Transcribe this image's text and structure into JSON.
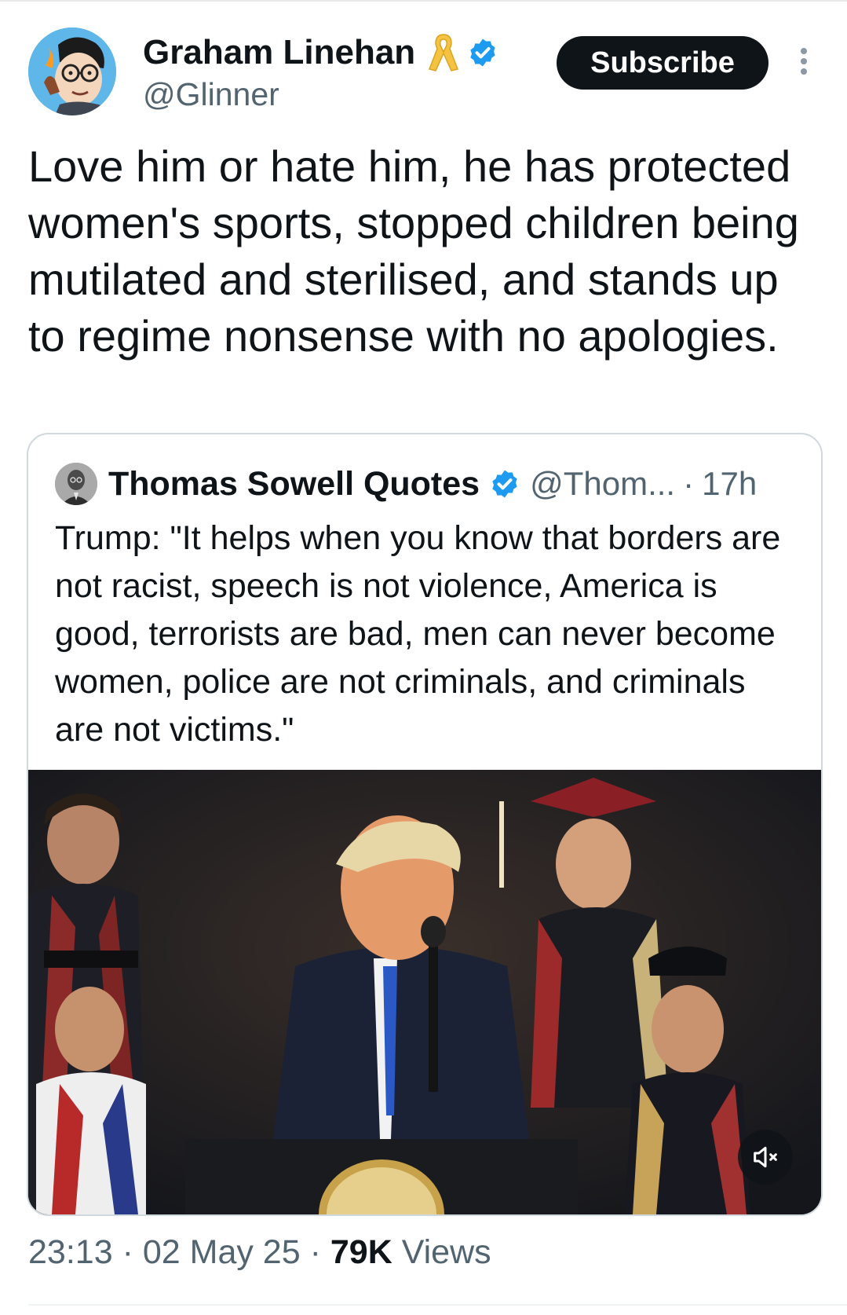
{
  "author": {
    "name": "Graham Linehan",
    "handle": "@Glinner",
    "avatar_icon": "cartoon-avatar-icon",
    "badges": [
      "yellow-ribbon-icon",
      "verified-badge-icon"
    ]
  },
  "header": {
    "subscribe_label": "Subscribe",
    "more_icon": "more-vertical-icon"
  },
  "tweet": {
    "text": "Love him or hate him, he has protected women's sports, stopped children being mutilated and sterilised, and stands up to regime nonsense with no apologies."
  },
  "quote": {
    "name": "Thomas Sowell Quotes",
    "handle": "@Thom...",
    "separator": "·",
    "time": "17h",
    "text": "Trump: \"It helps when you know that borders are not racist, speech is not violence, America is good, terrorists are bad, men can never become women, police are not criminals, and criminals are not victims.\"",
    "media": {
      "type": "video",
      "mute_icon": "volume-muted-icon"
    }
  },
  "meta": {
    "time": "23:13",
    "dot1": "·",
    "date": "02 May 25",
    "dot2": "·",
    "views_count": "79K",
    "views_label": "Views"
  },
  "colors": {
    "text_primary": "#0f1419",
    "text_secondary": "#536471",
    "verified": "#1d9bf0",
    "ribbon": "#f5c242",
    "border": "#cfd9de"
  }
}
